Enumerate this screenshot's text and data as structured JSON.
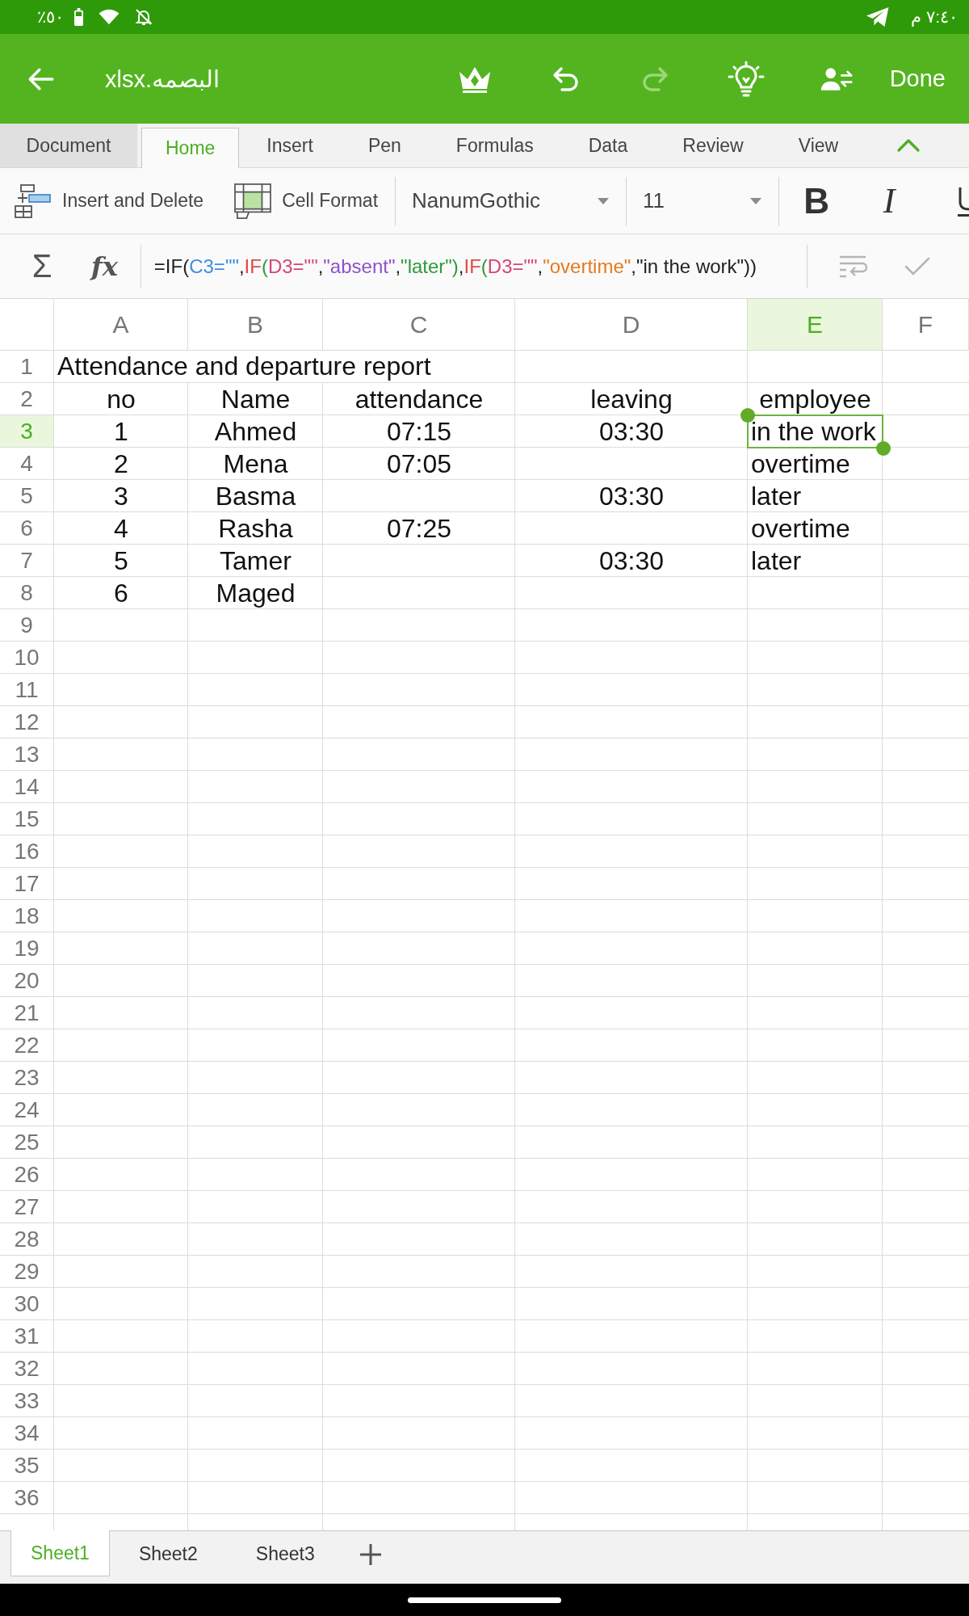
{
  "status_bar": {
    "battery": "٥٠٪",
    "time": "٧:٤٠ م"
  },
  "app_bar": {
    "title": "البصمه.xlsx",
    "actions": [
      {
        "kind": "crown",
        "disabled": false
      },
      {
        "kind": "undo",
        "disabled": false
      },
      {
        "kind": "redo",
        "disabled": true
      },
      {
        "kind": "lightbulb",
        "disabled": false
      },
      {
        "kind": "share",
        "disabled": false
      }
    ],
    "done": "Done"
  },
  "ribbon_tabs": [
    {
      "label": "Document",
      "kind": "file",
      "selected": false
    },
    {
      "label": "Home",
      "kind": "tab",
      "selected": true
    },
    {
      "label": "Insert",
      "kind": "tab",
      "selected": false
    },
    {
      "label": "Pen",
      "kind": "tab",
      "selected": false
    },
    {
      "label": "Formulas",
      "kind": "tab",
      "selected": false
    },
    {
      "label": "Data",
      "kind": "tab",
      "selected": false
    },
    {
      "label": "Review",
      "kind": "tab",
      "selected": false
    },
    {
      "label": "View",
      "kind": "tab",
      "selected": false
    }
  ],
  "ribbon": {
    "insert_delete": "Insert and Delete",
    "cell_format": "Cell Format",
    "font": "NanumGothic",
    "font_size": "11",
    "bold": "B",
    "italic": "I"
  },
  "formula_bar": {
    "sum": "Σ",
    "fx": "fx",
    "segments": [
      {
        "text": "=IF(",
        "color": "#222222"
      },
      {
        "text": "C3=\"\"",
        "color": "#3b8fe3"
      },
      {
        "text": ",",
        "color": "#222222"
      },
      {
        "text": "IF",
        "color": "#e04a45"
      },
      {
        "text": "(",
        "color": "#2e9a3c"
      },
      {
        "text": "D3=\"\"",
        "color": "#d6457a"
      },
      {
        "text": ",",
        "color": "#222222"
      },
      {
        "text": "\"absent\"",
        "color": "#8e52c8"
      },
      {
        "text": ",",
        "color": "#222222"
      },
      {
        "text": "\"later\")",
        "color": "#2e9a3c"
      },
      {
        "text": ",",
        "color": "#222222"
      },
      {
        "text": "IF",
        "color": "#e04a45"
      },
      {
        "text": "(",
        "color": "#2e9a3c"
      },
      {
        "text": "D3=\"\"",
        "color": "#d6457a"
      },
      {
        "text": ",",
        "color": "#222222"
      },
      {
        "text": "\"overtime\"",
        "color": "#e67a1e"
      },
      {
        "text": ",\"in the work\"))",
        "color": "#222222"
      }
    ]
  },
  "sheet": {
    "columns": [
      {
        "label": "A",
        "selected": false
      },
      {
        "label": "B",
        "selected": false
      },
      {
        "label": "C",
        "selected": false
      },
      {
        "label": "D",
        "selected": false
      },
      {
        "label": "E",
        "selected": true
      },
      {
        "label": "F",
        "selected": false
      }
    ],
    "rows": [
      {
        "label": "1",
        "kind": "title",
        "selected": false,
        "cells": [
          "Attendance and departure report"
        ]
      },
      {
        "label": "2",
        "kind": "header",
        "selected": false,
        "cells": [
          "no",
          "Name",
          "attendance",
          "leaving",
          "employee"
        ]
      },
      {
        "label": "3",
        "kind": "data",
        "selected": true,
        "cells": [
          "1",
          "Ahmed",
          "07:15",
          "03:30",
          "in the work"
        ]
      },
      {
        "label": "4",
        "kind": "data",
        "selected": false,
        "cells": [
          "2",
          "Mena",
          "07:05",
          null,
          "overtime"
        ]
      },
      {
        "label": "5",
        "kind": "data",
        "selected": false,
        "cells": [
          "3",
          "Basma",
          null,
          "03:30",
          "later"
        ]
      },
      {
        "label": "6",
        "kind": "data",
        "selected": false,
        "cells": [
          "4",
          "Rasha",
          "07:25",
          null,
          "overtime"
        ]
      },
      {
        "label": "7",
        "kind": "data",
        "selected": false,
        "cells": [
          "5",
          "Tamer",
          null,
          "03:30",
          "later"
        ]
      },
      {
        "label": "8",
        "kind": "data",
        "selected": false,
        "cells": [
          "6",
          "Maged"
        ]
      },
      {
        "label": "9",
        "selected": false
      },
      {
        "label": "10",
        "selected": false
      },
      {
        "label": "11",
        "selected": false
      },
      {
        "label": "12",
        "selected": false
      },
      {
        "label": "13",
        "selected": false
      },
      {
        "label": "14",
        "selected": false
      },
      {
        "label": "15",
        "selected": false
      },
      {
        "label": "16",
        "selected": false
      },
      {
        "label": "17",
        "selected": false
      },
      {
        "label": "18",
        "selected": false
      },
      {
        "label": "19",
        "selected": false
      },
      {
        "label": "20",
        "selected": false
      },
      {
        "label": "21",
        "selected": false
      },
      {
        "label": "22",
        "selected": false
      },
      {
        "label": "23",
        "selected": false
      },
      {
        "label": "24",
        "selected": false
      },
      {
        "label": "25",
        "selected": false
      },
      {
        "label": "26",
        "selected": false
      },
      {
        "label": "27",
        "selected": false
      },
      {
        "label": "28",
        "selected": false
      },
      {
        "label": "29",
        "selected": false
      },
      {
        "label": "30",
        "selected": false
      },
      {
        "label": "31",
        "selected": false
      },
      {
        "label": "32",
        "selected": false
      },
      {
        "label": "33",
        "selected": false
      },
      {
        "label": "34",
        "selected": false
      },
      {
        "label": "35",
        "selected": false
      },
      {
        "label": "36",
        "selected": false
      }
    ]
  },
  "sheet_tabs": [
    {
      "label": "Sheet1",
      "selected": true
    },
    {
      "label": "Sheet2",
      "selected": false
    },
    {
      "label": "Sheet3",
      "selected": false
    }
  ]
}
